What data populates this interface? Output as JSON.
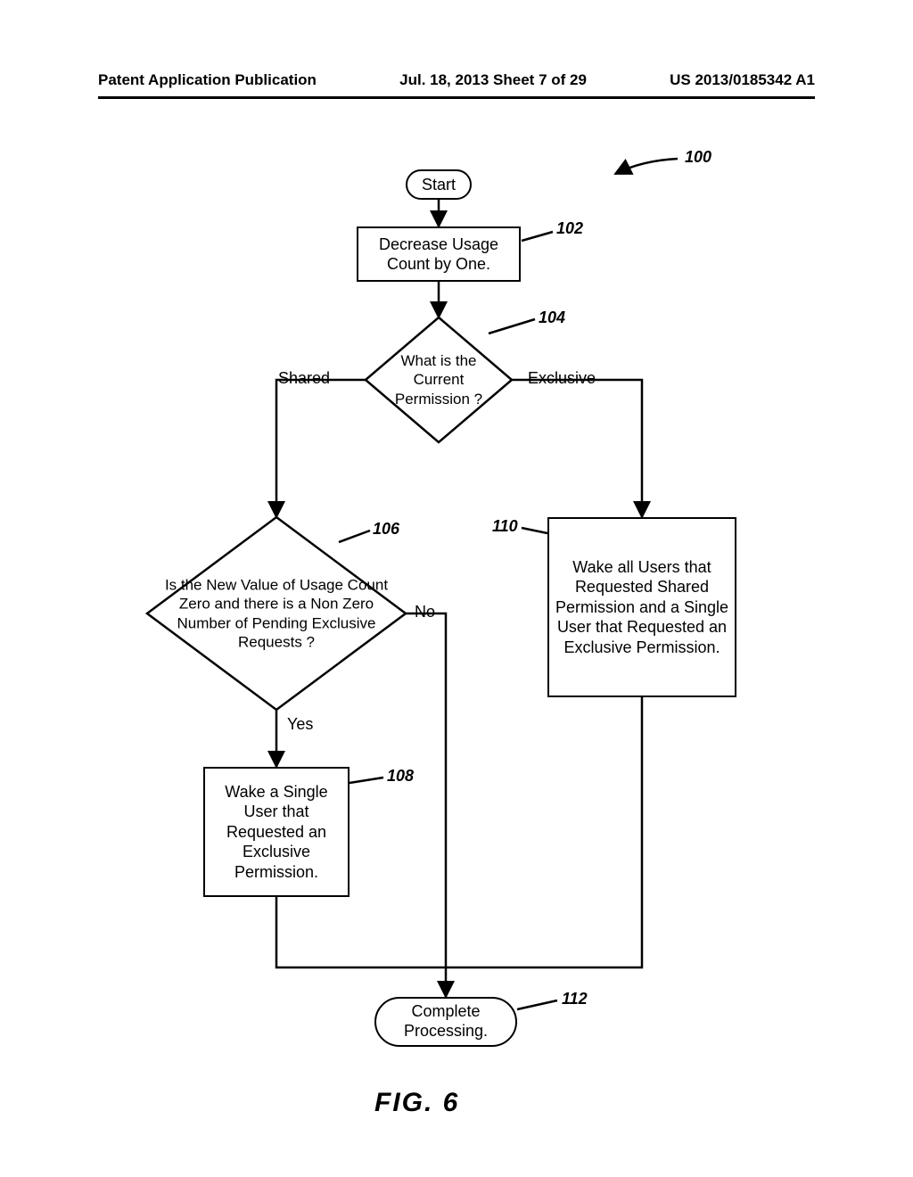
{
  "header": {
    "left": "Patent Application Publication",
    "center": "Jul. 18, 2013  Sheet 7 of 29",
    "right": "US 2013/0185342 A1"
  },
  "refs": {
    "fig": "100",
    "step102": "102",
    "step104": "104",
    "step106": "106",
    "step108": "108",
    "step110": "110",
    "step112": "112"
  },
  "nodes": {
    "start": "Start",
    "n102": "Decrease Usage Count by One.",
    "n104": "What is the Current Permission ?",
    "n104_shared": "Shared",
    "n104_exclusive": "Exclusive",
    "n106": "Is the New Value of Usage Count Zero and there is a Non Zero Number of Pending Exclusive Requests ?",
    "n106_yes": "Yes",
    "n106_no": "No",
    "n108": "Wake a Single User that Requested an Exclusive Permission.",
    "n110": "Wake all Users that Requested Shared Permission and a Single User that Requested an Exclusive Permission.",
    "n112": "Complete Processing."
  },
  "caption": "FIG.  6"
}
